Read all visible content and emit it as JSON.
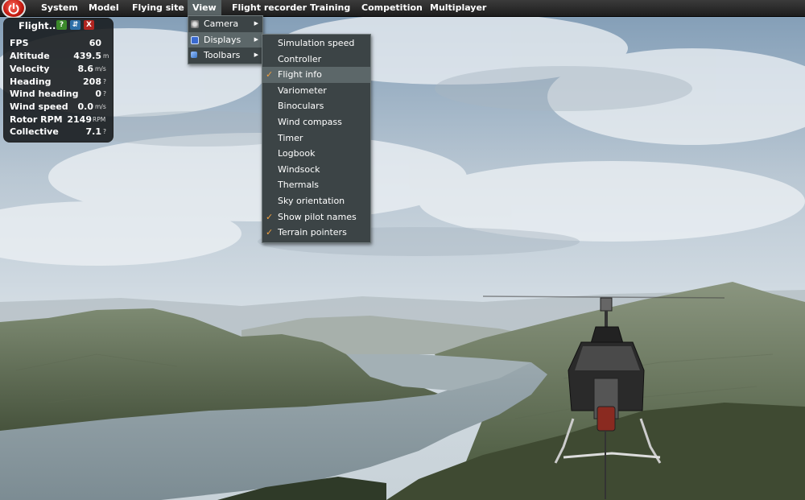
{
  "menubar": {
    "items": [
      "System",
      "Model",
      "Flying site",
      "View",
      "Flight recorder",
      "Training",
      "Competition",
      "Multiplayer"
    ],
    "active": "View"
  },
  "view_menu": {
    "items": [
      {
        "label": "Camera",
        "icon": "camera-icon",
        "submenu": true
      },
      {
        "label": "Displays",
        "icon": "displays-icon",
        "submenu": true
      },
      {
        "label": "Toolbars",
        "icon": "toolbars-icon",
        "submenu": true
      }
    ]
  },
  "displays_menu": {
    "items": [
      {
        "label": "Simulation speed",
        "checked": false
      },
      {
        "label": "Controller",
        "checked": false
      },
      {
        "label": "Flight info",
        "checked": true
      },
      {
        "label": "Variometer",
        "checked": false
      },
      {
        "label": "Binoculars",
        "checked": false
      },
      {
        "label": "Wind compass",
        "checked": false
      },
      {
        "label": "Timer",
        "checked": false
      },
      {
        "label": "Logbook",
        "checked": false
      },
      {
        "label": "Windsock",
        "checked": false
      },
      {
        "label": "Thermals",
        "checked": false
      },
      {
        "label": "Sky orientation",
        "checked": false
      },
      {
        "label": "Show pilot names",
        "checked": true
      },
      {
        "label": "Terrain pointers",
        "checked": true
      }
    ],
    "check_glyph": "✓"
  },
  "flight_info": {
    "title": "Flight...",
    "buttons": {
      "help": "?",
      "pin": "⇵",
      "close": "X"
    },
    "rows": [
      {
        "label": "FPS",
        "value": "60",
        "unit": ""
      },
      {
        "label": "Altitude",
        "value": "439.5",
        "unit": "m"
      },
      {
        "label": "Velocity",
        "value": "8.6",
        "unit": "m/s"
      },
      {
        "label": "Heading",
        "value": "208",
        "unit": "?"
      },
      {
        "label": "Wind heading",
        "value": "0",
        "unit": "?"
      },
      {
        "label": "Wind speed",
        "value": "0.0",
        "unit": "m/s"
      },
      {
        "label": "Rotor RPM",
        "value": "2149",
        "unit": "RPM"
      },
      {
        "label": "Collective",
        "value": "7.1",
        "unit": "?"
      }
    ]
  },
  "colors": {
    "menubar": "#2a2a2a",
    "menu_bg": "#3c4446",
    "menu_highlight": "#5c6769",
    "check": "#f0a040",
    "power": "#c41a10"
  }
}
